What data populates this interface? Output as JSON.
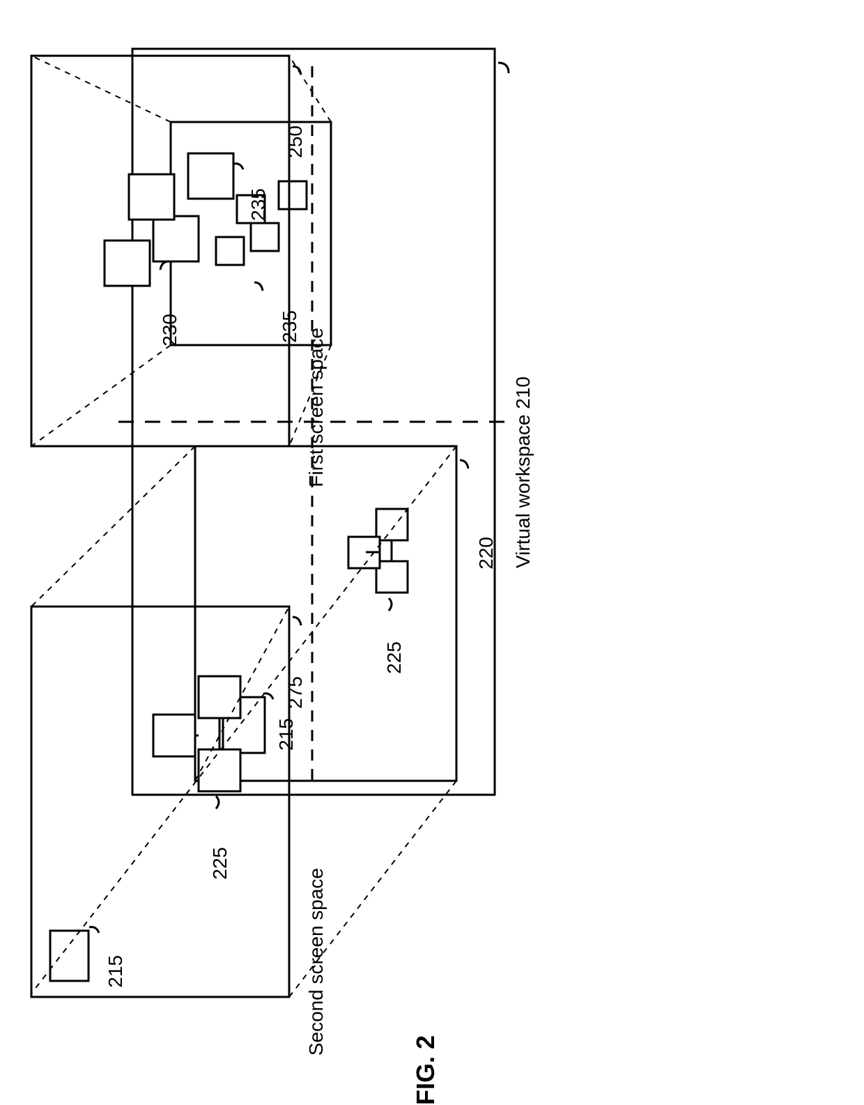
{
  "figure": {
    "number": "FIG. 2"
  },
  "labels": {
    "virtual_workspace": {
      "text": "Virtual workspace",
      "ref": "210"
    },
    "first_screen_space": {
      "text": "First screen space",
      "ref": "250"
    },
    "second_screen_space": {
      "text": "Second screen space",
      "ref": "275"
    },
    "viewport_a": {
      "ref": "220"
    },
    "group_a": {
      "ref": "225"
    },
    "item_a": {
      "ref": "215"
    },
    "viewport_b": {
      "ref": "230"
    },
    "group_b": {
      "ref": "235"
    },
    "group_a_in_second": {
      "ref": "225"
    },
    "item_a_in_second": {
      "ref": "215"
    },
    "group_b_in_first": {
      "ref": "235"
    }
  }
}
